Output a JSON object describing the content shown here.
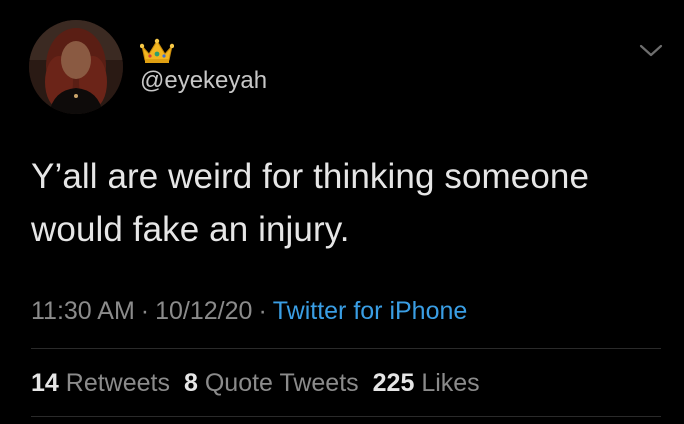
{
  "author": {
    "display_name_icon": "crown-emoji",
    "handle": "@eyekeyah"
  },
  "tweet": {
    "text_line1": "Y’all are weird for thinking someone",
    "text_line2": "would fake an injury."
  },
  "meta": {
    "time": "11:30 AM",
    "separator": "·",
    "date": "10/12/20",
    "source": "Twitter for iPhone"
  },
  "stats": {
    "retweets_count": "14",
    "retweets_label": "Retweets",
    "quotes_count": "8",
    "quotes_label": "Quote Tweets",
    "likes_count": "225",
    "likes_label": "Likes"
  },
  "colors": {
    "background": "#000000",
    "text": "#e6e6e6",
    "secondary": "#8b8b8b",
    "link": "#3a9ee4",
    "crown": "#f2b51f"
  }
}
